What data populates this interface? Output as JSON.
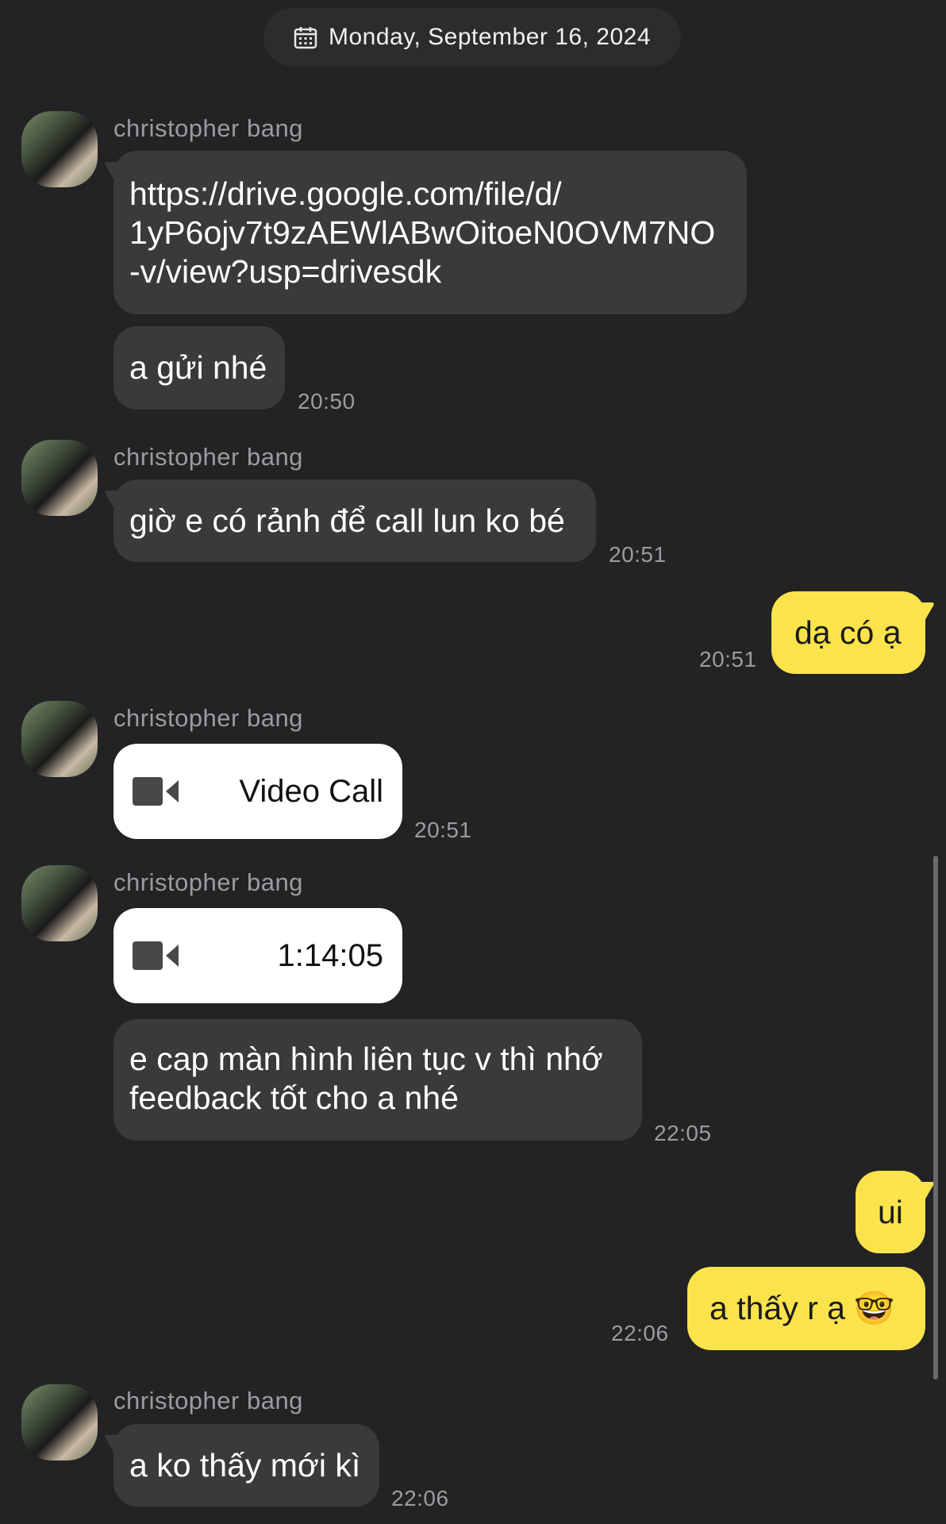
{
  "date_header": {
    "icon": "calendar-icon",
    "text": "Monday, September 16, 2024"
  },
  "messages": [
    {
      "sender": "christopher bang",
      "lines": [
        "https://drive.google.com/file/d/",
        "1yP6ojv7t9zAEWlABwOitoeN0OVM7NO",
        "-v/view?usp=drivesdk"
      ]
    },
    {
      "text": "a gửi nhé",
      "time": "20:50"
    },
    {
      "sender": "christopher bang",
      "text": "giờ e có rảnh để call lun ko bé",
      "time": "20:51"
    },
    {
      "mine": true,
      "text": "dạ có ạ",
      "time": "20:51"
    },
    {
      "sender": "christopher bang",
      "call_label": "Video Call",
      "icon": "video-camera-icon",
      "time": "20:51"
    },
    {
      "sender": "christopher bang",
      "call_label": "1:14:05",
      "icon": "video-camera-icon"
    },
    {
      "lines": [
        "e cap màn hình liên tục v thì nhớ",
        "feedback tốt cho a nhé"
      ],
      "time": "22:05"
    },
    {
      "mine": true,
      "text": "ui"
    },
    {
      "mine": true,
      "text": "a thấy r ạ 🤓",
      "time": "22:06"
    },
    {
      "sender": "christopher bang",
      "text": "a ko thấy mới kì",
      "time": "22:06"
    }
  ],
  "colors": {
    "background": "#232325",
    "incoming_bubble": "#3a3a3c",
    "outgoing_bubble": "#fbe34b",
    "call_card": "#ffffff",
    "timestamp": "#9c9ca0"
  }
}
